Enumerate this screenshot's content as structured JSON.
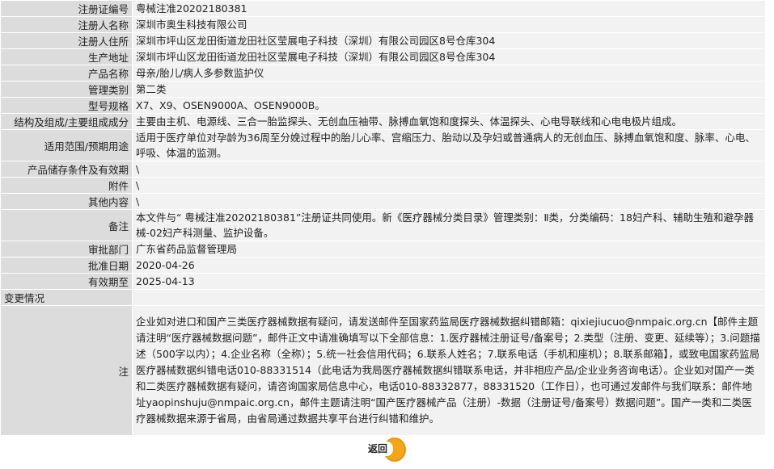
{
  "rows": [
    {
      "label": "注册证编号",
      "value": "粤械注准20202180381"
    },
    {
      "label": "注册人名称",
      "value": "深圳市奥生科技有限公司"
    },
    {
      "label": "注册人住所",
      "value": "深圳市坪山区龙田街道龙田社区莹展电子科技（深圳）有限公司园区8号仓库304"
    },
    {
      "label": "生产地址",
      "value": "深圳市坪山区龙田街道龙田社区莹展电子科技（深圳）有限公司园区8号仓库304"
    },
    {
      "label": "产品名称",
      "value": "母亲/胎儿/病人多参数监护仪"
    },
    {
      "label": "管理类别",
      "value": "第二类"
    },
    {
      "label": "型号规格",
      "value": "X7、X9、OSEN9000A、OSEN9000B。"
    },
    {
      "label": "结构及组成/主要组成成分",
      "value": "主要由主机、电源线、三合一胎监探头、无创血压袖带、脉搏血氧饱和度探头、体温探头、心电导联线和心电电极片组成。"
    },
    {
      "label": "适用范围/预期用途",
      "value": "适用于医疗单位对孕龄为36周至分娩过程中的胎儿心率、宫缩压力、胎动以及孕妇或普通病人的无创血压、脉搏血氧饱和度、脉率、心电、呼吸、体温的监测。"
    },
    {
      "label": "产品储存条件及有效期",
      "value": "\\"
    },
    {
      "label": "附件",
      "value": "\\"
    },
    {
      "label": "其他内容",
      "value": "\\"
    },
    {
      "label": "备注",
      "value": "本文件与“ 粤械注准20202180381”注册证共同使用。新《医疗器械分类目录》管理类别：Ⅱ类，分类编码：18妇产科、辅助生殖和避孕器械-02妇产科测量、监护设备。"
    },
    {
      "label": "审批部门",
      "value": "广东省药品监督管理局"
    },
    {
      "label": "批准日期",
      "value": "2020-04-26"
    },
    {
      "label": "有效期至",
      "value": "2025-04-13"
    }
  ],
  "change_label": "变更情况",
  "change_value": "",
  "note_label": "注",
  "note_text": "企业如对进口和国产三类医疗器械数据有疑问，请发送邮件至国家药监局医疗器械数据纠错邮箱：qixiejiucuo@nmpaic.org.cn【邮件主题请注明“医疗器械数据问题”，邮件正文中请准确填写以下全部信息：1.医疗器械注册证号/备案号；2.类型（注册、变更、延续等）；3.问题描述（500字以内）；4.企业名称（全称）；5.统一社会信用代码；6.联系人姓名；7.联系电话（手机和座机）；8.联系邮箱】，或致电国家药监局医疗器械数据纠错电话010-88331514（此电话为我局医疗器械数据纠错联系电话，并非相应产品/企业业务咨询电话）。企业如对国产一类和二类医疗器械数据有疑问，请咨询国家局信息中心，电话010-88332877，88331520（工作日），也可通过发邮件与我们联系：邮件地址yaopinshuju@nmpaic.org.cn，邮件主题请注明“国产医疗器械产品（注册）-数据（注册证号/备案号）数据问题”。国产一类和二类医疗器械数据来源于省局，由省局通过数据共享平台进行纠错和维护。",
  "back_label": "返回",
  "colors": {
    "label_bg": "#dcdcdc",
    "value_bg": "#f2f2f2",
    "button_orange": "#f3a718"
  }
}
